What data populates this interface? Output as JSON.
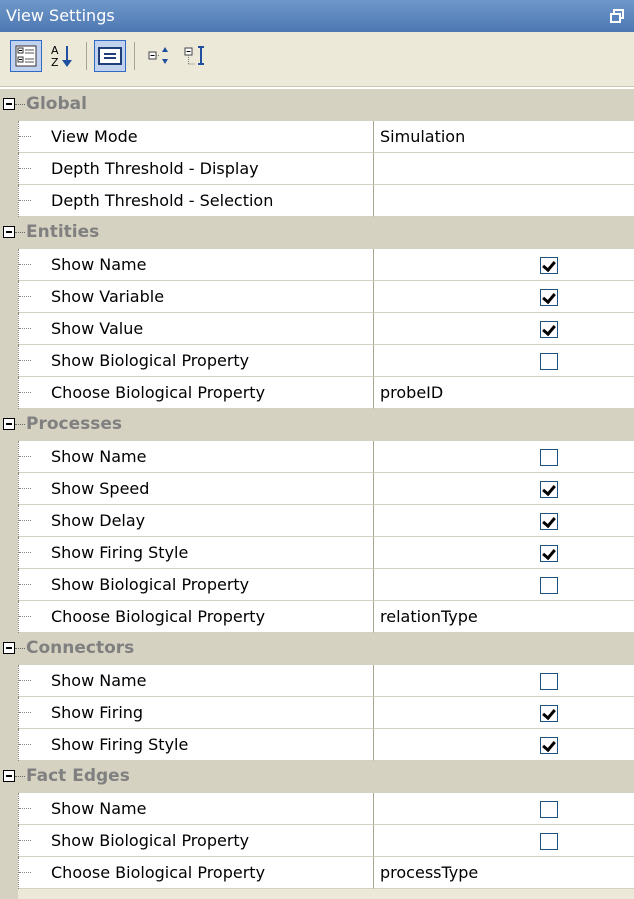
{
  "window": {
    "title": "View Settings"
  },
  "toolbar": {
    "buttons": [
      {
        "name": "categorized-button",
        "icon": "categorized-icon"
      },
      {
        "name": "alphabetical-button",
        "icon": "sort-az-icon"
      },
      {
        "name": "property-pages-button",
        "icon": "property-pages-icon"
      },
      {
        "name": "expand-all-button",
        "icon": "expand-all-icon"
      },
      {
        "name": "collapse-all-button",
        "icon": "collapse-all-icon"
      }
    ]
  },
  "grid": {
    "categories": [
      {
        "label": "Global",
        "properties": [
          {
            "name": "View Mode",
            "value": "Simulation"
          },
          {
            "name": "Depth Threshold - Display",
            "value": ""
          },
          {
            "name": "Depth Threshold - Selection",
            "value": ""
          }
        ]
      },
      {
        "label": "Entities",
        "properties": [
          {
            "name": "Show Name",
            "checked": true
          },
          {
            "name": "Show Variable",
            "checked": true
          },
          {
            "name": "Show Value",
            "checked": true
          },
          {
            "name": "Show Biological Property",
            "checked": false
          },
          {
            "name": "Choose Biological Property",
            "value": "probeID"
          }
        ]
      },
      {
        "label": "Processes",
        "properties": [
          {
            "name": "Show Name",
            "checked": false
          },
          {
            "name": "Show Speed",
            "checked": true
          },
          {
            "name": "Show Delay",
            "checked": true
          },
          {
            "name": "Show Firing Style",
            "checked": true
          },
          {
            "name": "Show Biological Property",
            "checked": false
          },
          {
            "name": "Choose Biological Property",
            "value": "relationType"
          }
        ]
      },
      {
        "label": "Connectors",
        "properties": [
          {
            "name": "Show Name",
            "checked": false
          },
          {
            "name": "Show Firing",
            "checked": true
          },
          {
            "name": "Show Firing Style",
            "checked": true
          }
        ]
      },
      {
        "label": "Fact Edges",
        "properties": [
          {
            "name": "Show Name",
            "checked": false
          },
          {
            "name": "Show Biological Property",
            "checked": false
          },
          {
            "name": "Choose Biological Property",
            "value": "processType"
          }
        ]
      }
    ]
  },
  "colors": {
    "titlebar": "#5a83bd",
    "toolbar": "#ece9d8",
    "category_row": "#d6d2c2",
    "category_text": "#808080",
    "checkbox_border": "#1c5180"
  }
}
